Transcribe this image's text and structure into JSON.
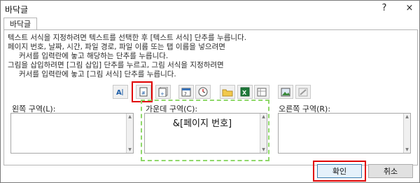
{
  "window": {
    "title": "바닥글",
    "help_glyph": "?",
    "close_glyph": "×"
  },
  "tab": {
    "label": "바닥글"
  },
  "instructions": [
    "텍스트 서식을 지정하려면 텍스트를 선택한 후 [텍스트 서식] 단추를 누릅니다.",
    "페이지 번호, 날짜, 시간, 파일 경로, 파일 이름 또는 탭 이름을 넣으려면",
    "커서를 입력란에 놓고 해당하는 단추를 누릅니다.",
    "그림을 삽입하려면 [그림 삽입] 단추를 누르고, 그림 서식을 지정하려면",
    "커서를 입력란에 놓고 [그림 서식] 단추를 누릅니다."
  ],
  "toolbar": {
    "icons": [
      "format-text-icon",
      "insert-page-number-icon",
      "insert-number-of-pages-icon",
      "insert-date-icon",
      "insert-time-icon",
      "insert-file-path-icon",
      "insert-file-name-icon",
      "insert-sheet-name-icon",
      "insert-picture-icon",
      "format-picture-icon"
    ],
    "highlighted_icon": "insert-page-number-icon"
  },
  "sections": {
    "left": {
      "label": "왼쪽 구역(L):",
      "value": ""
    },
    "center": {
      "label": "가운데 구역(C):",
      "value": "&[페이지 번호]"
    },
    "right": {
      "label": "오른쪽 구역(R):",
      "value": ""
    }
  },
  "buttons": {
    "ok": "확인",
    "cancel": "취소"
  },
  "colors": {
    "highlight_red": "#e00000",
    "highlight_green": "#8fd86a"
  }
}
